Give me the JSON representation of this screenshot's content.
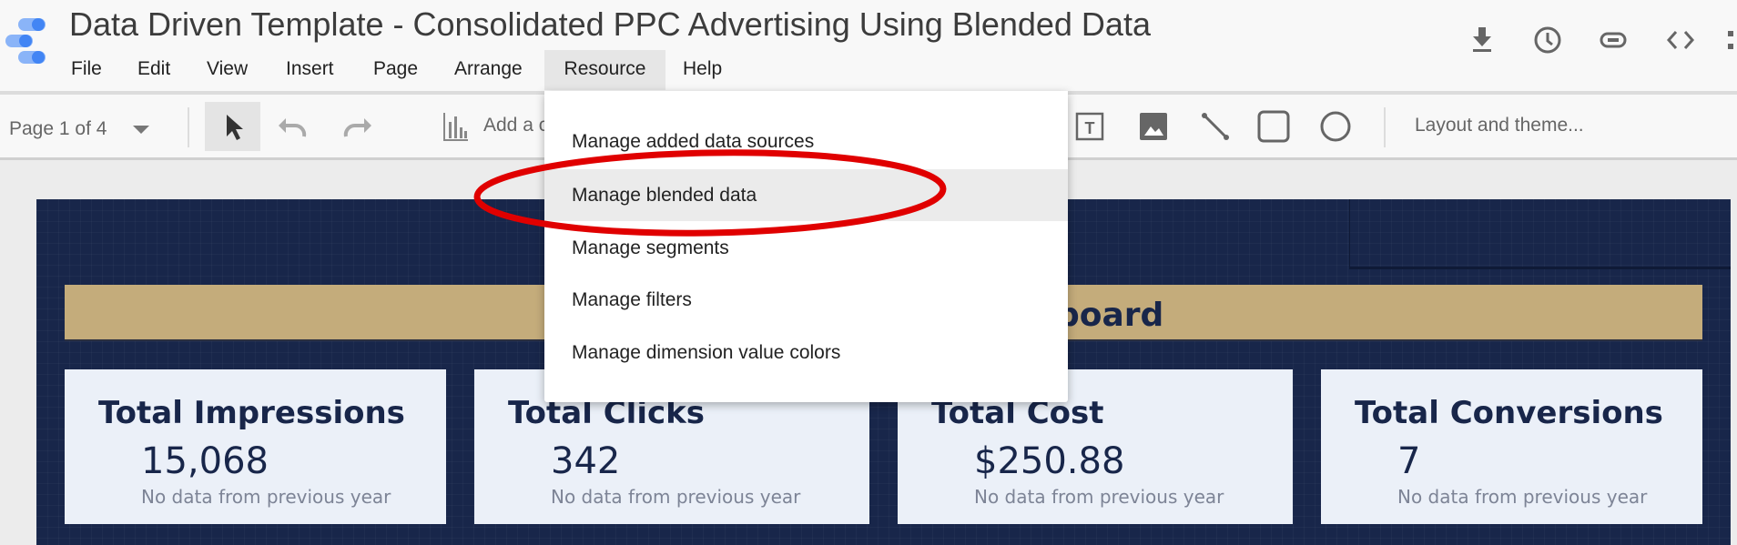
{
  "app": {
    "title": "Data Driven Template - Consolidated PPC Advertising Using Blended Data",
    "logo": "looker-studio-logo"
  },
  "menubar": [
    "File",
    "Edit",
    "View",
    "Insert",
    "Page",
    "Arrange",
    "Resource",
    "Help"
  ],
  "active_menu": "Resource",
  "header_icons": [
    "download-icon",
    "history-icon",
    "link-icon",
    "embed-icon",
    "more-icon"
  ],
  "toolbar": {
    "page_selector": "Page 1 of 4",
    "add_chart": "Add a c",
    "layout_theme": "Layout and theme...",
    "icons": [
      "select-icon",
      "undo-icon",
      "redo-icon",
      "chart-icon",
      "text-box-icon",
      "image-icon",
      "line-icon",
      "rectangle-icon",
      "circle-icon"
    ]
  },
  "resource_menu": {
    "items": [
      "Manage added data sources",
      "Manage blended data",
      "Manage segments",
      "Manage filters",
      "Manage dimension value colors"
    ],
    "highlighted": "Manage blended data",
    "annotation_color": "#e00000"
  },
  "dashboard": {
    "banner_text": "board",
    "cards": [
      {
        "title": "Total Impressions",
        "value": "15,068",
        "subtitle": "No data from previous year"
      },
      {
        "title": "Total Clicks",
        "value": "342",
        "subtitle": "No data from previous year"
      },
      {
        "title": "Total Cost",
        "value": "$250.88",
        "subtitle": "No data from previous year"
      },
      {
        "title": "Total Conversions",
        "value": "7",
        "subtitle": "No data from previous year"
      }
    ],
    "colors": {
      "background": "#18264a",
      "banner": "#c4ac7b",
      "card": "#ebf0f8"
    }
  }
}
